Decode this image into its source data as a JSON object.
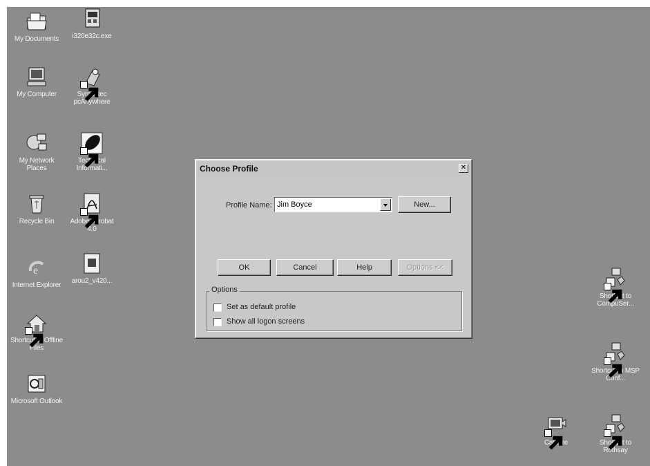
{
  "desktop": {
    "background": "#8c8c8c",
    "icons_left": [
      {
        "label": "My Documents",
        "icon": "folder-documents-icon"
      },
      {
        "label": "i320e32c.exe",
        "icon": "executable-icon"
      },
      {
        "label": "My Computer",
        "icon": "computer-icon"
      },
      {
        "label": "Symantec pcAnywhere",
        "icon": "pcanywhere-shortcut-icon"
      },
      {
        "label": "My Network Places",
        "icon": "network-icon"
      },
      {
        "label": "Technical Informati...",
        "icon": "leaf-document-icon"
      },
      {
        "label": "Recycle Bin",
        "icon": "recycle-bin-icon"
      },
      {
        "label": "Adobe Acrobat 4.0",
        "icon": "acrobat-shortcut-icon"
      },
      {
        "label": "Internet Explorer",
        "icon": "internet-explorer-icon"
      },
      {
        "label": "arou2_v420...",
        "icon": "document-icon"
      },
      {
        "label": "Shortcut to Offline Files",
        "icon": "offline-files-shortcut-icon"
      },
      {
        "label": "Microsoft Outlook",
        "icon": "outlook-icon"
      }
    ],
    "icons_right": [
      {
        "label": "Shortcut to CompuSer...",
        "icon": "network-shortcut-icon"
      },
      {
        "label": "Shortcut to MSP Conf...",
        "icon": "network-shortcut-icon"
      },
      {
        "label": "Capture",
        "icon": "capture-shortcut-icon"
      },
      {
        "label": "Shortcut to Rothsay",
        "icon": "network-shortcut-icon"
      }
    ]
  },
  "dialog": {
    "title": "Choose Profile",
    "profile_label": "Profile Name:",
    "profile_value": "Jim Boyce",
    "new_button": "New...",
    "ok_button": "OK",
    "cancel_button": "Cancel",
    "help_button": "Help",
    "options_button": "Options <<",
    "options_group_label": "Options",
    "checkbox_default": "Set as default profile",
    "checkbox_logon": "Show all logon screens",
    "checkbox_default_checked": false,
    "checkbox_logon_checked": false
  }
}
